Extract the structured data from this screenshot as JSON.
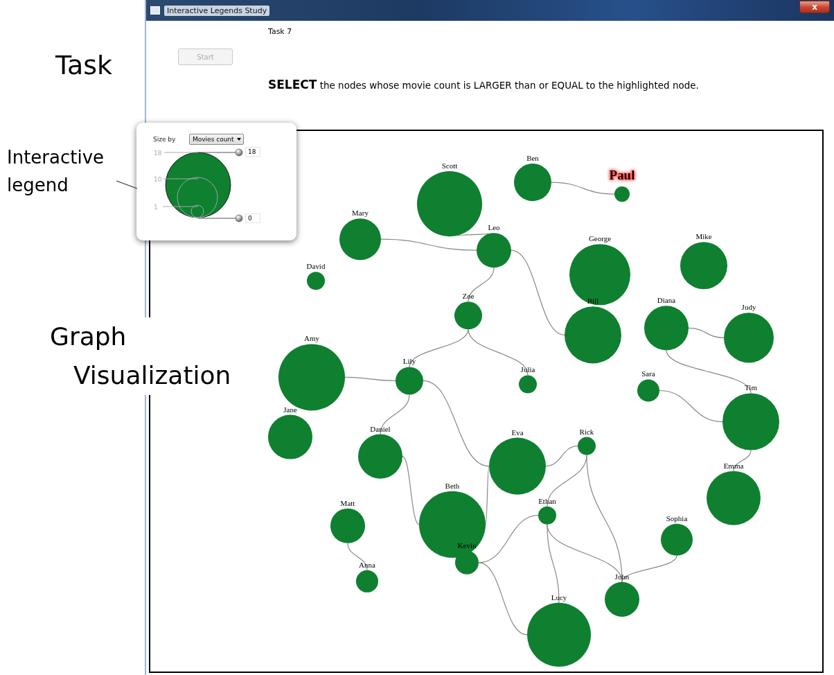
{
  "window": {
    "title": "Interactive Legends Study",
    "close_label": "x"
  },
  "annotations": [
    "Task",
    "Interactive legend",
    "Graph Visualization"
  ],
  "task": {
    "title": "Task 7",
    "start_button": {
      "label": "Start",
      "disabled": true
    },
    "instruction": "**SELECT** the nodes whose movie count is LARGER than or EQUAL to the highlighted node."
  },
  "legend": {
    "size_by_label": "Size by",
    "dropdown": "Movies count",
    "scale_labels": [
      "18",
      "10",
      "1"
    ],
    "max_field": "18",
    "min_field": "0"
  },
  "graph": {
    "nodes": [
      {
        "name": "Scott",
        "highlighted": false
      },
      {
        "name": "Ben",
        "highlighted": false
      },
      {
        "name": "Paul",
        "highlighted": true
      },
      {
        "name": "Mary",
        "highlighted": false
      },
      {
        "name": "Leo",
        "highlighted": false
      },
      {
        "name": "George",
        "highlighted": false
      },
      {
        "name": "Mike",
        "highlighted": false
      },
      {
        "name": "David",
        "highlighted": false
      },
      {
        "name": "Zoe",
        "highlighted": false
      },
      {
        "name": "Bill",
        "highlighted": false
      },
      {
        "name": "Diana",
        "highlighted": false
      },
      {
        "name": "Judy",
        "highlighted": false
      },
      {
        "name": "Amy",
        "highlighted": false
      },
      {
        "name": "Lily",
        "highlighted": false
      },
      {
        "name": "Julia",
        "highlighted": false
      },
      {
        "name": "Sara",
        "highlighted": false
      },
      {
        "name": "Tim",
        "highlighted": false
      },
      {
        "name": "Jane",
        "highlighted": false
      },
      {
        "name": "Daniel",
        "highlighted": false
      },
      {
        "name": "Eva",
        "highlighted": false
      },
      {
        "name": "Rick",
        "highlighted": false
      },
      {
        "name": "Emma",
        "highlighted": false
      },
      {
        "name": "Matt",
        "highlighted": false
      },
      {
        "name": "Beth",
        "highlighted": false
      },
      {
        "name": "Ethan",
        "highlighted": false
      },
      {
        "name": "Sophia",
        "highlighted": false
      },
      {
        "name": "Kevin",
        "highlighted": false
      },
      {
        "name": "Anna",
        "highlighted": false
      },
      {
        "name": "John",
        "highlighted": false
      },
      {
        "name": "Lucy",
        "highlighted": false
      }
    ]
  }
}
